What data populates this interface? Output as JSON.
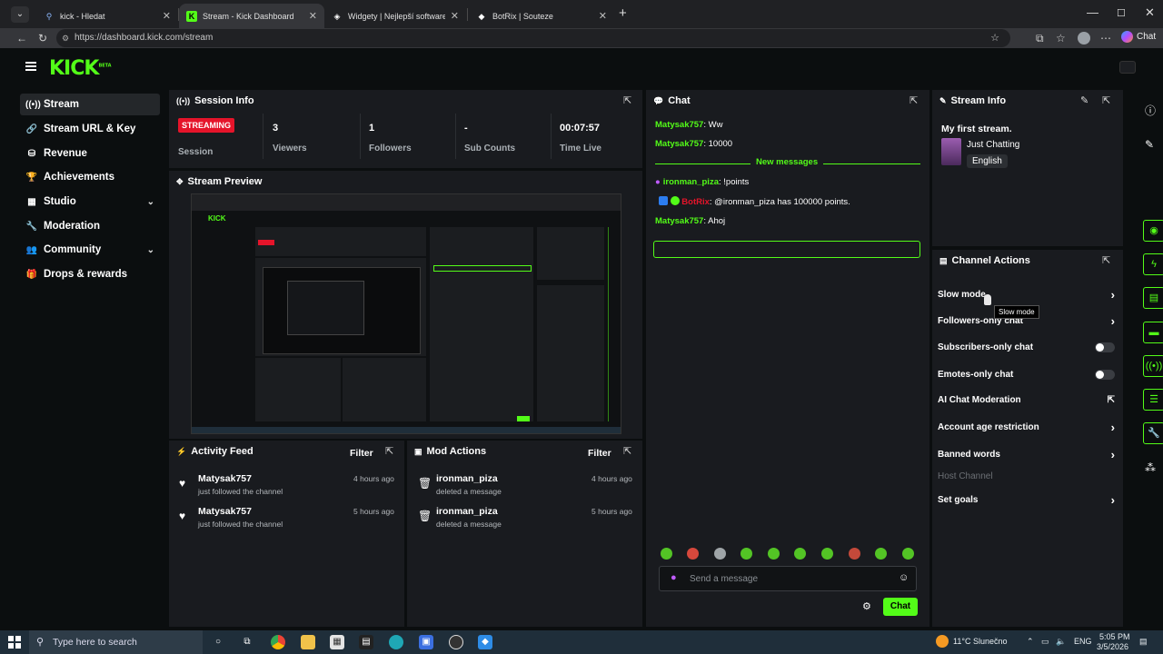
{
  "browser": {
    "tabs": [
      {
        "title": "kick - Hledat",
        "favicon": "search-icon"
      },
      {
        "title": "Stream - Kick Dashboard",
        "favicon": "kick-icon"
      },
      {
        "title": "Widgety | Nejlepší software pro v...",
        "favicon": "widget-icon"
      },
      {
        "title": "BotRix | Souteze",
        "favicon": "botrix-icon"
      }
    ],
    "url": "https://dashboard.kick.com/stream",
    "chat_button": "Chat"
  },
  "kick": {
    "logo": "KICK",
    "logo_sup": "BETA",
    "accent": "#53fc18",
    "nav": [
      {
        "label": "Stream",
        "icon": "broadcast-icon"
      },
      {
        "label": "Stream URL & Key",
        "icon": "link-icon"
      },
      {
        "label": "Revenue",
        "icon": "coins-icon"
      },
      {
        "label": "Achievements",
        "icon": "trophy-icon"
      },
      {
        "label": "Studio",
        "icon": "studio-icon"
      },
      {
        "label": "Moderation",
        "icon": "wrench-icon"
      },
      {
        "label": "Community",
        "icon": "users-icon"
      },
      {
        "label": "Drops & rewards",
        "icon": "gift-icon"
      }
    ],
    "session": {
      "title": "Session Info",
      "status": "STREAMING",
      "status_label": "Session",
      "stats": [
        {
          "value": "3",
          "label": "Viewers"
        },
        {
          "value": "1",
          "label": "Followers"
        },
        {
          "value": "-",
          "label": "Sub Counts"
        },
        {
          "value": "00:07:57",
          "label": "Time Live"
        }
      ]
    },
    "preview": {
      "title": "Stream Preview"
    },
    "activity": {
      "title": "Activity Feed",
      "filter": "Filter",
      "rows": [
        {
          "name": "Matysak757",
          "sub": "just followed the channel",
          "time": "4 hours ago"
        },
        {
          "name": "Matysak757",
          "sub": "just followed the channel",
          "time": "5 hours ago"
        }
      ]
    },
    "mod": {
      "title": "Mod Actions",
      "filter": "Filter",
      "rows": [
        {
          "name": "ironman_piza",
          "sub": "deleted a message",
          "time": "4 hours ago"
        },
        {
          "name": "ironman_piza",
          "sub": "deleted a message",
          "time": "5 hours ago"
        }
      ]
    },
    "chat": {
      "title": "Chat",
      "messages": [
        {
          "user": "Matysak757",
          "text": ": Ww"
        },
        {
          "user": "Matysak757",
          "text": ": 10000"
        }
      ],
      "divider": "New messages",
      "new_messages": [
        {
          "user": "ironman_piza",
          "text": ": !points"
        },
        {
          "user": "BotRix",
          "text": ": @ironman_piza has 100000 points."
        },
        {
          "user": "Matysak757",
          "text": ": Ahoj"
        }
      ],
      "placeholder": "Send a message",
      "send": "Chat"
    },
    "stream_info": {
      "title": "Stream Info",
      "stream_title": "My first stream.",
      "category": "Just Chatting",
      "language": "English"
    },
    "channel_actions": {
      "title": "Channel Actions",
      "rows": [
        {
          "label": "Slow mode",
          "control": "chevron"
        },
        {
          "label": "Followers-only chat",
          "control": "chevron"
        },
        {
          "label": "Subscribers-only chat",
          "control": "toggle"
        },
        {
          "label": "Emotes-only chat",
          "control": "toggle"
        },
        {
          "label": "AI Chat Moderation",
          "control": "external"
        },
        {
          "label": "Account age restriction",
          "control": "chevron"
        },
        {
          "label": "Banned words",
          "control": "chevron"
        },
        {
          "label": "Host Channel",
          "control": "none"
        },
        {
          "label": "Set goals",
          "control": "chevron"
        }
      ],
      "tooltip": "Slow mode"
    }
  },
  "taskbar": {
    "search_placeholder": "Type here to search",
    "weather": "11°C  Slunečno",
    "lang": "ENG",
    "time": "5:05 PM",
    "date": "3/5/2026"
  }
}
